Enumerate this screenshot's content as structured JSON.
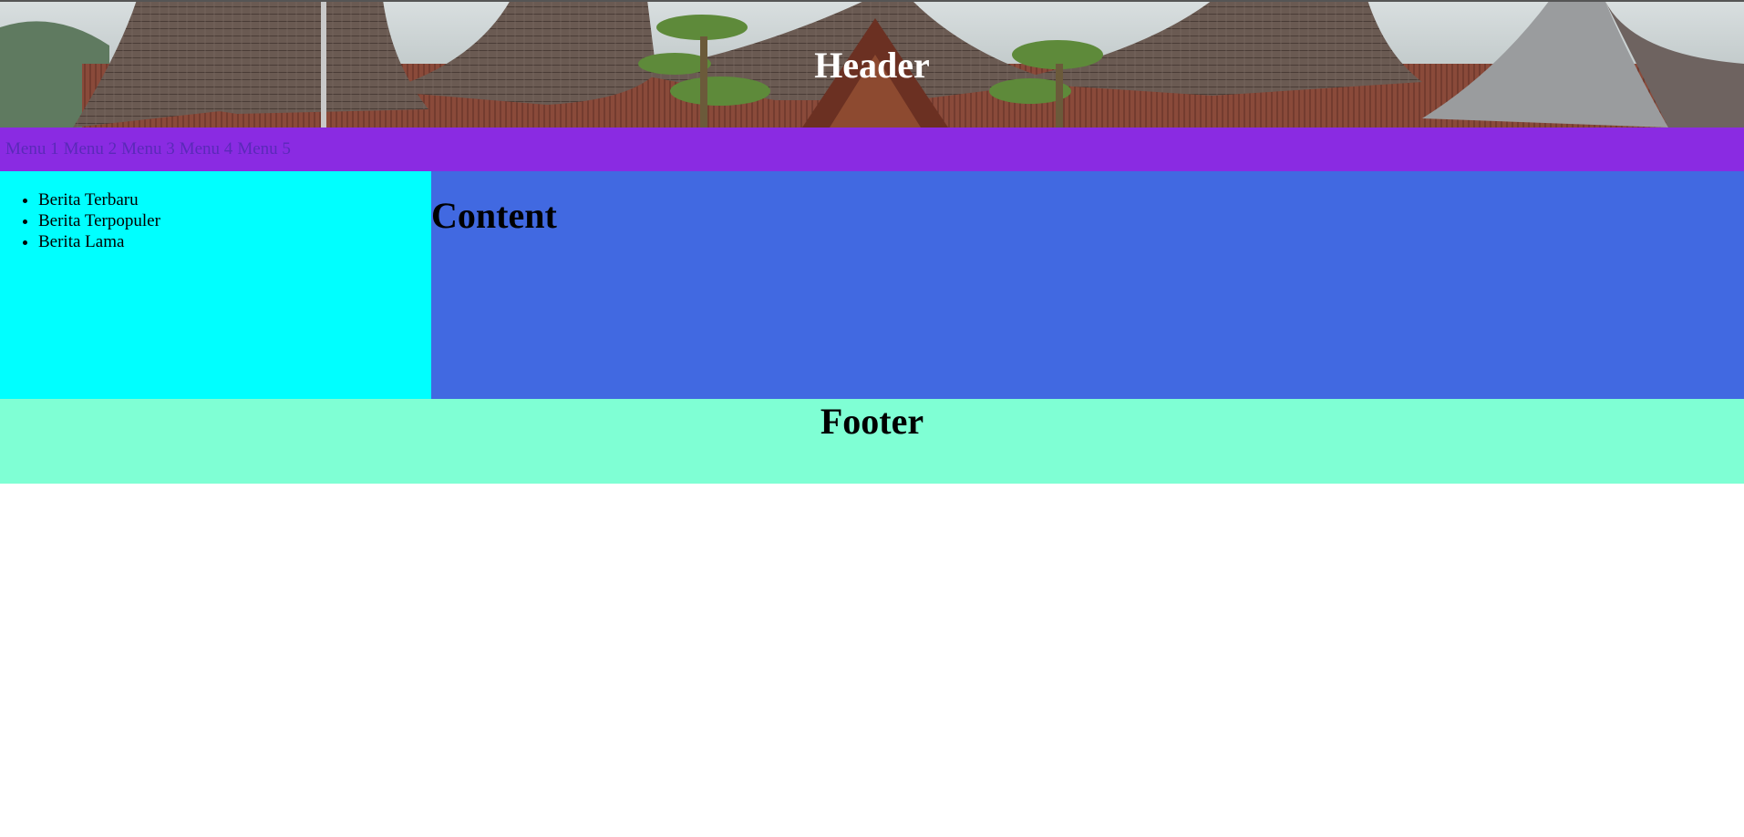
{
  "header": {
    "title": "Header"
  },
  "nav": {
    "items": [
      "Menu 1",
      "Menu 2",
      "Menu 3",
      "Menu 4",
      "Menu 5"
    ]
  },
  "sidebar": {
    "items": [
      "Berita Terbaru",
      "Berita Terpopuler",
      "Berita Lama"
    ]
  },
  "content": {
    "title": "Content"
  },
  "footer": {
    "title": "Footer"
  },
  "colors": {
    "nav_bg": "#8a2be2",
    "sidebar_bg": "#00ffff",
    "content_bg": "#4169e1",
    "footer_bg": "#7fffd4"
  }
}
